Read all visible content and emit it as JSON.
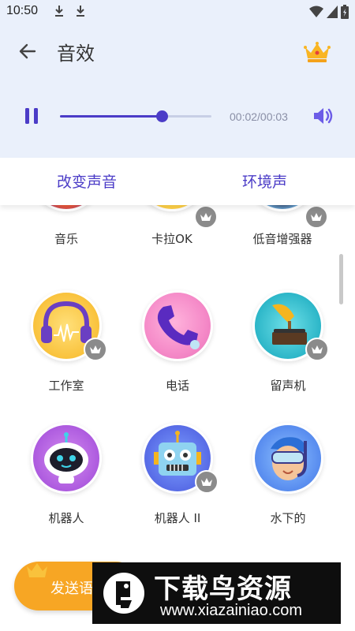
{
  "status_bar": {
    "time": "10:50"
  },
  "header": {
    "title": "音效",
    "back_icon": "arrow-left-icon",
    "vip_icon": "crown-icon"
  },
  "player": {
    "time_readout": "00:02/00:03",
    "progress": 0.67,
    "state_icon": "pause-icon",
    "volume_icon": "volume-icon"
  },
  "tabs": [
    {
      "label": "改变声音"
    },
    {
      "label": "环境声"
    }
  ],
  "colors": {
    "accent": "#4b3cc7",
    "header_bg": "#eaf0fb",
    "send_button": "#f7a624",
    "vip_badge": "#8b8b8b"
  },
  "effects": [
    {
      "label": "音乐",
      "vip": false
    },
    {
      "label": "卡拉OK",
      "vip": true
    },
    {
      "label": "低音增强器",
      "vip": true
    },
    {
      "label": "工作室",
      "vip": true
    },
    {
      "label": "电话",
      "vip": false
    },
    {
      "label": "留声机",
      "vip": true
    },
    {
      "label": "机器人",
      "vip": false
    },
    {
      "label": "机器人 II",
      "vip": true
    },
    {
      "label": "水下的",
      "vip": false
    }
  ],
  "send_button": {
    "label": "发送语"
  },
  "banner": {
    "title": "下载鸟资源",
    "url": "www.xiazainiao.com"
  }
}
